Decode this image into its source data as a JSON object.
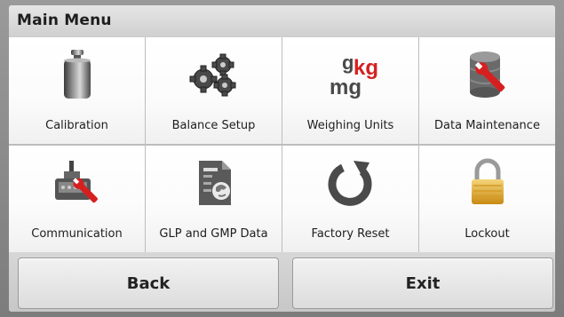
{
  "header": {
    "title": "Main Menu"
  },
  "menu": {
    "items": [
      {
        "label": "Calibration",
        "icon": "calibration-weight-icon"
      },
      {
        "label": "Balance Setup",
        "icon": "gears-icon"
      },
      {
        "label": "Weighing Units",
        "icon": "units-icon"
      },
      {
        "label": "Data Maintenance",
        "icon": "database-wrench-icon"
      },
      {
        "label": "Communication",
        "icon": "connector-wrench-icon"
      },
      {
        "label": "GLP and GMP Data",
        "icon": "document-globe-icon"
      },
      {
        "label": "Factory Reset",
        "icon": "reset-arrow-icon"
      },
      {
        "label": "Lockout",
        "icon": "padlock-icon"
      }
    ],
    "units_icon_text": {
      "g": "g",
      "kg": "kg",
      "mg": "mg"
    }
  },
  "footer": {
    "back_label": "Back",
    "exit_label": "Exit"
  },
  "colors": {
    "accent_red": "#d62020",
    "lock_gold": "#e0a92a",
    "grid_line": "#bdbdbd"
  }
}
